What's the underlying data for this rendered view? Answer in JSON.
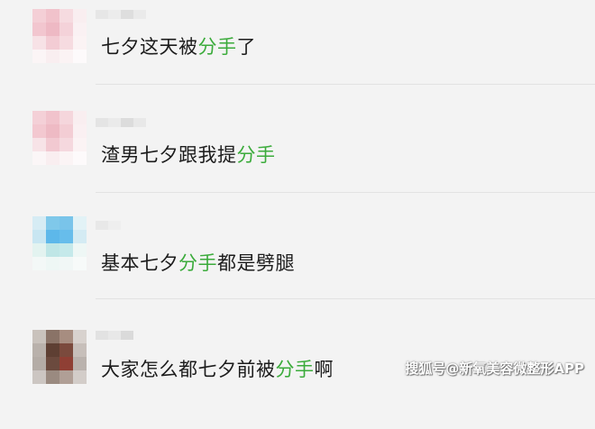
{
  "conversations": [
    {
      "avatar_tones": [
        "#f4cfd6",
        "#f1c2cb",
        "#f6dbe0",
        "#f9eef0",
        "#f2c6cf",
        "#eeb9c4",
        "#f4d2d9",
        "#faf1f3",
        "#f7e2e6",
        "#f3ccd4",
        "#f6dbe0",
        "#fbf3f4",
        "#fbf5f6",
        "#f9eef0",
        "#fbf3f4",
        "#fdfafb"
      ],
      "name_tones": [
        "#e6e6e6",
        "#ececec",
        "#dedede",
        "#eaeaea"
      ],
      "message_before": "七夕这天被",
      "message_highlight": "分手",
      "message_after": "了"
    },
    {
      "avatar_tones": [
        "#f4d0d7",
        "#f1c3cc",
        "#f5d6dc",
        "#f9eef0",
        "#f3c8d0",
        "#eebac4",
        "#f3cdd4",
        "#faf0f2",
        "#f7e3e7",
        "#f2c9d1",
        "#f5d8de",
        "#fbf3f4",
        "#fbf6f7",
        "#f9eef0",
        "#fbf4f5",
        "#fdfafb"
      ],
      "name_tones": [
        "#e4e4e4",
        "#eaeaea",
        "#dcdcdc",
        "#e8e8e8"
      ],
      "message_before": "渣男七夕跟我提",
      "message_highlight": "分手",
      "message_after": ""
    },
    {
      "avatar_tones": [
        "#d6ecf4",
        "#7fc8ea",
        "#79c4ea",
        "#e2f2f6",
        "#c8e6f2",
        "#5db8ea",
        "#67bdeb",
        "#d4ebf3",
        "#e3f3f0",
        "#bfe6e6",
        "#c5e9ea",
        "#eef7f5",
        "#f3f8f7",
        "#eef7f5",
        "#f1f7f6",
        "#f7faf9"
      ],
      "name_tones": [
        "#e8e8e8",
        "#eeeeee"
      ],
      "message_before": "基本七夕",
      "message_highlight": "分手",
      "message_after": "都是劈腿"
    },
    {
      "avatar_tones": [
        "#c9c2bc",
        "#8a7367",
        "#a78d80",
        "#d8d2ce",
        "#b9b1ab",
        "#5e3f33",
        "#7b4a3d",
        "#c7bfba",
        "#b4aca6",
        "#6b4a3e",
        "#8f3f34",
        "#bab2ad",
        "#ccc6c2",
        "#9a8a80",
        "#b09f96",
        "#d3cdc9"
      ],
      "name_tones": [
        "#e2e2e2",
        "#e8e8e8",
        "#dadada"
      ],
      "message_before": "大家怎么都七夕前被",
      "message_highlight": "分手",
      "message_after": "啊"
    }
  ],
  "watermark": "搜狐号@新氧美容微整形APP",
  "colors": {
    "background": "#f3f3f3",
    "highlight": "#3bab3b",
    "text": "#1c1c1c",
    "divider": "#e2e2e2"
  }
}
